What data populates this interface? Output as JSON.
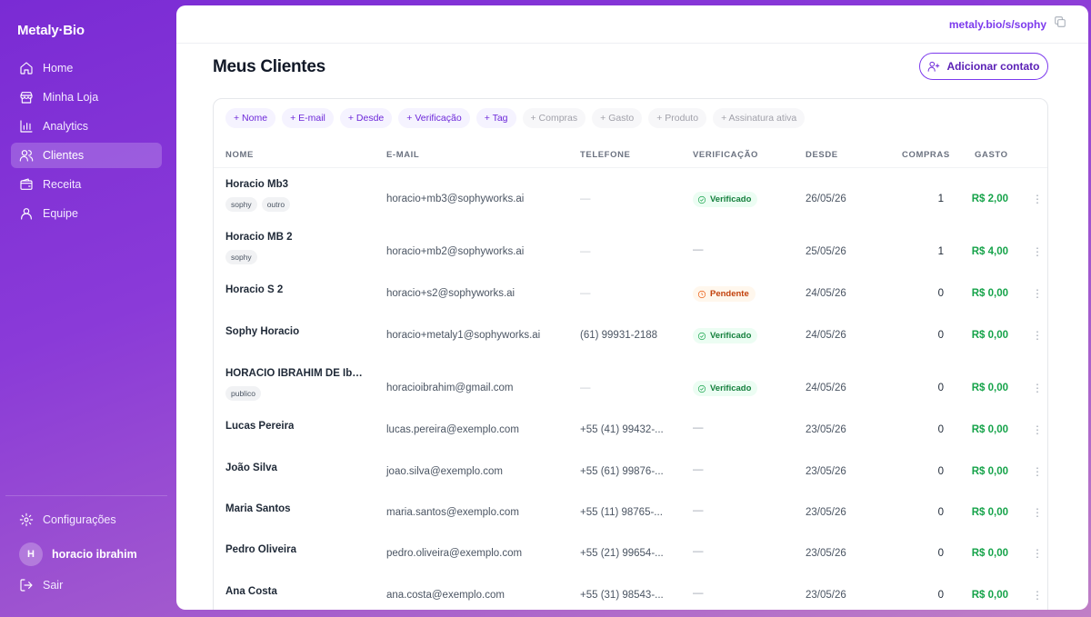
{
  "app": {
    "logo": "Metaly·Bio"
  },
  "sidebar": {
    "items": [
      {
        "label": "Home",
        "icon": "home-icon"
      },
      {
        "label": "Minha Loja",
        "icon": "store-icon"
      },
      {
        "label": "Analytics",
        "icon": "chart-icon"
      },
      {
        "label": "Clientes",
        "icon": "users-icon",
        "active": true
      },
      {
        "label": "Receita",
        "icon": "wallet-icon"
      },
      {
        "label": "Equipe",
        "icon": "team-icon"
      }
    ],
    "settings_label": "Configurações",
    "user": {
      "initial": "H",
      "name": "horacio ibrahim"
    },
    "logout_label": "Sair"
  },
  "header": {
    "url": "metaly.bio/s/sophy"
  },
  "page": {
    "title": "Meus Clientes",
    "add_button": "Adicionar contato"
  },
  "filters": [
    {
      "label": "+ Nome",
      "active": true
    },
    {
      "label": "+ E-mail",
      "active": true
    },
    {
      "label": "+ Desde",
      "active": true
    },
    {
      "label": "+ Verificação",
      "active": true
    },
    {
      "label": "+ Tag",
      "active": true
    },
    {
      "label": "+ Compras",
      "active": false
    },
    {
      "label": "+ Gasto",
      "active": false
    },
    {
      "label": "+ Produto",
      "active": false
    },
    {
      "label": "+ Assinatura ativa",
      "active": false
    }
  ],
  "table": {
    "headers": {
      "name": "NOME",
      "email": "E-MAIL",
      "phone": "TELEFONE",
      "verification": "VERIFICAÇÃO",
      "since": "DESDE",
      "purchases": "COMPRAS",
      "spent": "GASTO"
    },
    "rows": [
      {
        "name": "Horacio Mb3",
        "tags": [
          "sophy",
          "outro"
        ],
        "email": "horacio+mb3@sophyworks.ai",
        "phone": "—",
        "verification": "Verificado",
        "status": "ok",
        "since": "26/05/26",
        "purchases": "1",
        "spent": "R$ 2,00"
      },
      {
        "name": "Horacio MB 2",
        "tags": [
          "sophy"
        ],
        "email": "horacio+mb2@sophyworks.ai",
        "phone": "—",
        "verification": "—",
        "status": "none",
        "since": "25/05/26",
        "purchases": "1",
        "spent": "R$ 4,00"
      },
      {
        "name": "Horacio S 2",
        "tags": [],
        "email": "horacio+s2@sophyworks.ai",
        "phone": "—",
        "verification": "Pendente",
        "status": "pend",
        "since": "24/05/26",
        "purchases": "0",
        "spent": "R$ 0,00"
      },
      {
        "name": "Sophy Horacio",
        "tags": [],
        "email": "horacio+metaly1@sophyworks.ai",
        "phone": "(61) 99931-2188",
        "verification": "Verificado",
        "status": "ok",
        "since": "24/05/26",
        "purchases": "0",
        "spent": "R$ 0,00"
      },
      {
        "name": "HORACIO IBRAHIM DE Ibrahim",
        "tags": [
          "publico"
        ],
        "email": "horacioibrahim@gmail.com",
        "phone": "—",
        "verification": "Verificado",
        "status": "ok",
        "since": "24/05/26",
        "purchases": "0",
        "spent": "R$ 0,00"
      },
      {
        "name": "Lucas Pereira",
        "tags": [],
        "email": "lucas.pereira@exemplo.com",
        "phone": "+55 (41) 99432-...",
        "verification": "—",
        "status": "none",
        "since": "23/05/26",
        "purchases": "0",
        "spent": "R$ 0,00"
      },
      {
        "name": "João Silva",
        "tags": [],
        "email": "joao.silva@exemplo.com",
        "phone": "+55 (61) 99876-...",
        "verification": "—",
        "status": "none",
        "since": "23/05/26",
        "purchases": "0",
        "spent": "R$ 0,00"
      },
      {
        "name": "Maria Santos",
        "tags": [],
        "email": "maria.santos@exemplo.com",
        "phone": "+55 (11) 98765-...",
        "verification": "—",
        "status": "none",
        "since": "23/05/26",
        "purchases": "0",
        "spent": "R$ 0,00"
      },
      {
        "name": "Pedro Oliveira",
        "tags": [],
        "email": "pedro.oliveira@exemplo.com",
        "phone": "+55 (21) 99654-...",
        "verification": "—",
        "status": "none",
        "since": "23/05/26",
        "purchases": "0",
        "spent": "R$ 0,00"
      },
      {
        "name": "Ana Costa",
        "tags": [],
        "email": "ana.costa@exemplo.com",
        "phone": "+55 (31) 98543-...",
        "verification": "—",
        "status": "none",
        "since": "23/05/26",
        "purchases": "0",
        "spent": "R$ 0,00"
      }
    ]
  },
  "colors": {
    "accent": "#7c3aed",
    "success": "#16a34a",
    "warning": "#ea580c"
  }
}
